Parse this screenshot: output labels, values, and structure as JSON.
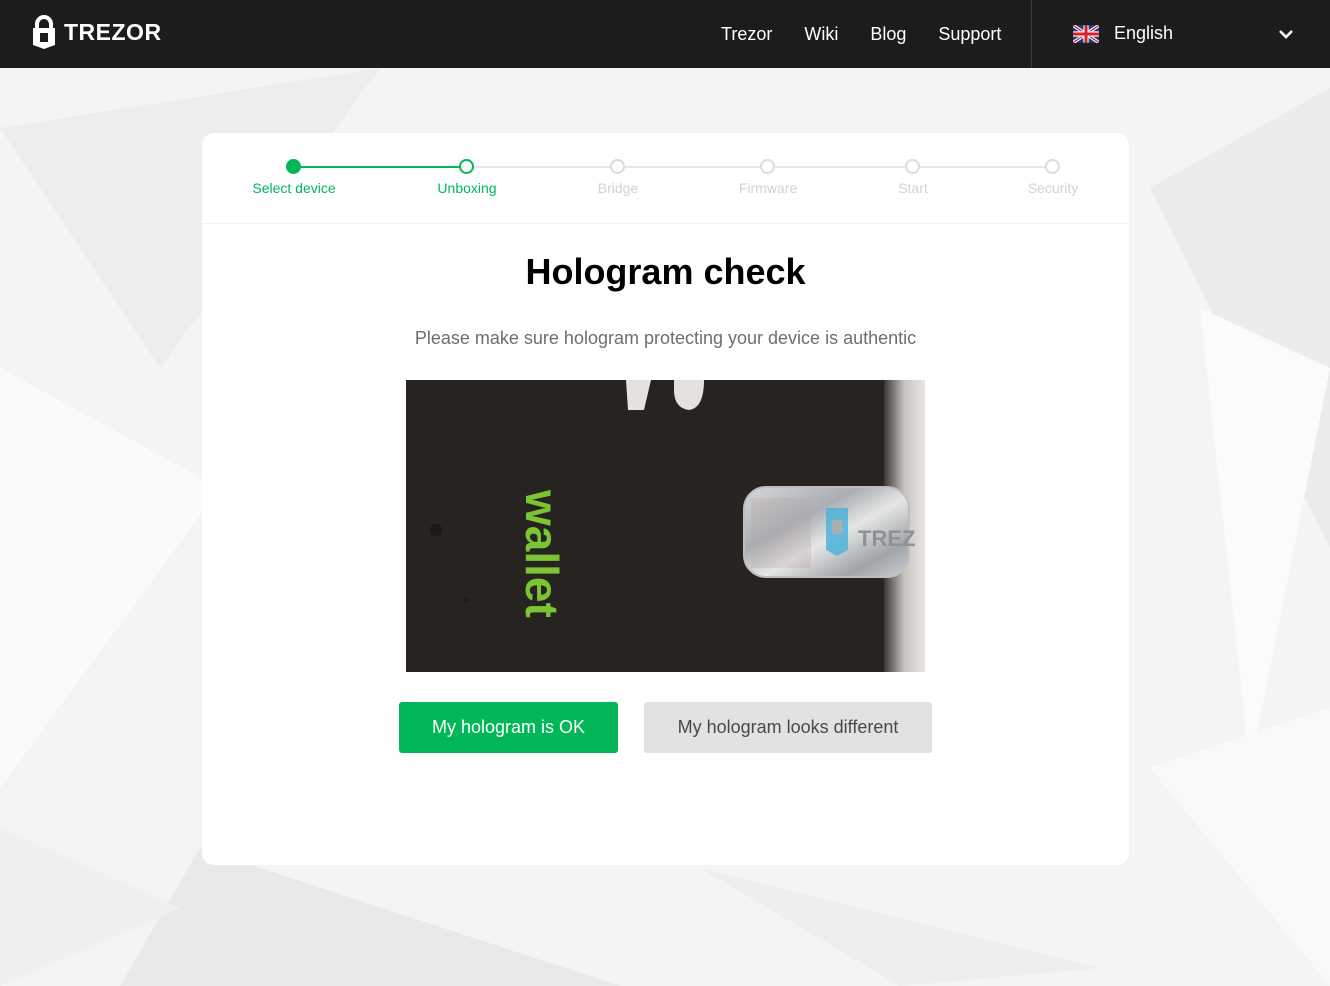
{
  "header": {
    "brand": "TREZOR",
    "nav": [
      "Trezor",
      "Wiki",
      "Blog",
      "Support"
    ],
    "language": "English",
    "language_flag": "uk-flag-icon"
  },
  "steps": [
    {
      "label": "Select device",
      "state": "done"
    },
    {
      "label": "Unboxing",
      "state": "active"
    },
    {
      "label": "Bridge",
      "state": "pending"
    },
    {
      "label": "Firmware",
      "state": "pending"
    },
    {
      "label": "Start",
      "state": "pending"
    },
    {
      "label": "Security",
      "state": "pending"
    }
  ],
  "content": {
    "title": "Hologram check",
    "subtitle": "Please make sure hologram protecting your device is authentic",
    "photo_text": "wallet",
    "hologram_text": "TREZ"
  },
  "buttons": {
    "ok": "My hologram is OK",
    "different": "My hologram looks different"
  },
  "colors": {
    "accent": "#01b757",
    "header_bg": "#1c1c1c",
    "secondary_button": "#e2e2e2"
  }
}
